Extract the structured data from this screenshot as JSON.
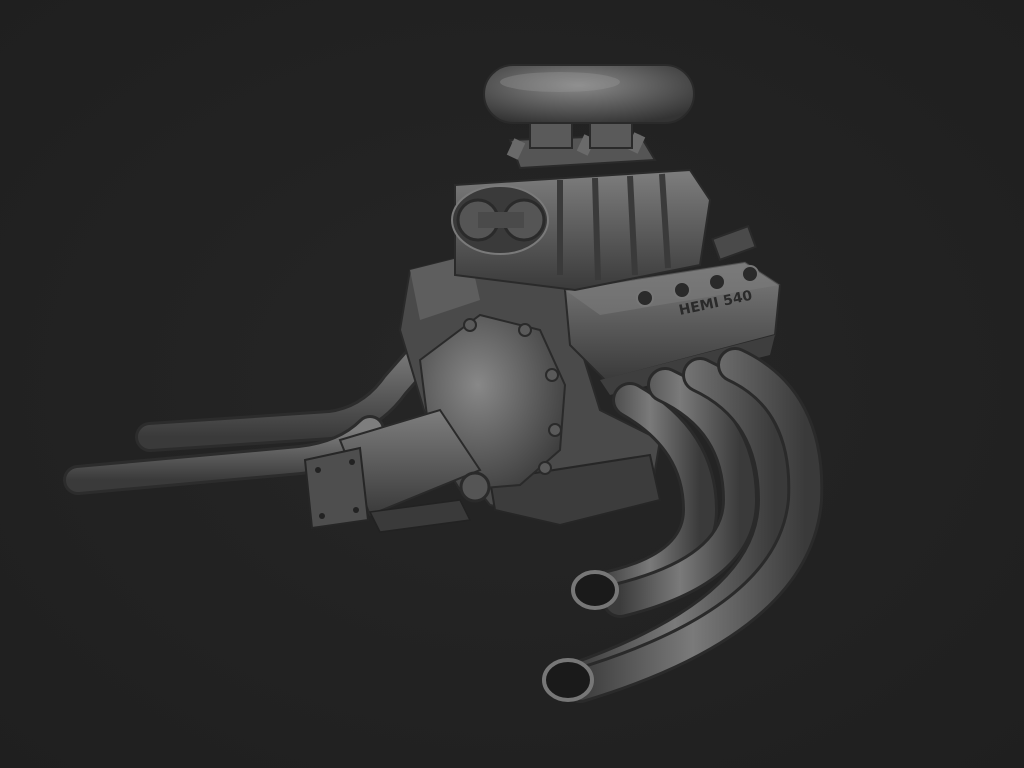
{
  "scene": {
    "background_color": "#222222",
    "subject": "engine-render"
  },
  "engine": {
    "valve_cover_text": "HEMI 540",
    "base_color": "#5a5a5a",
    "highlight_color": "#8a8a8a",
    "shadow_color": "#2e2e2e"
  }
}
